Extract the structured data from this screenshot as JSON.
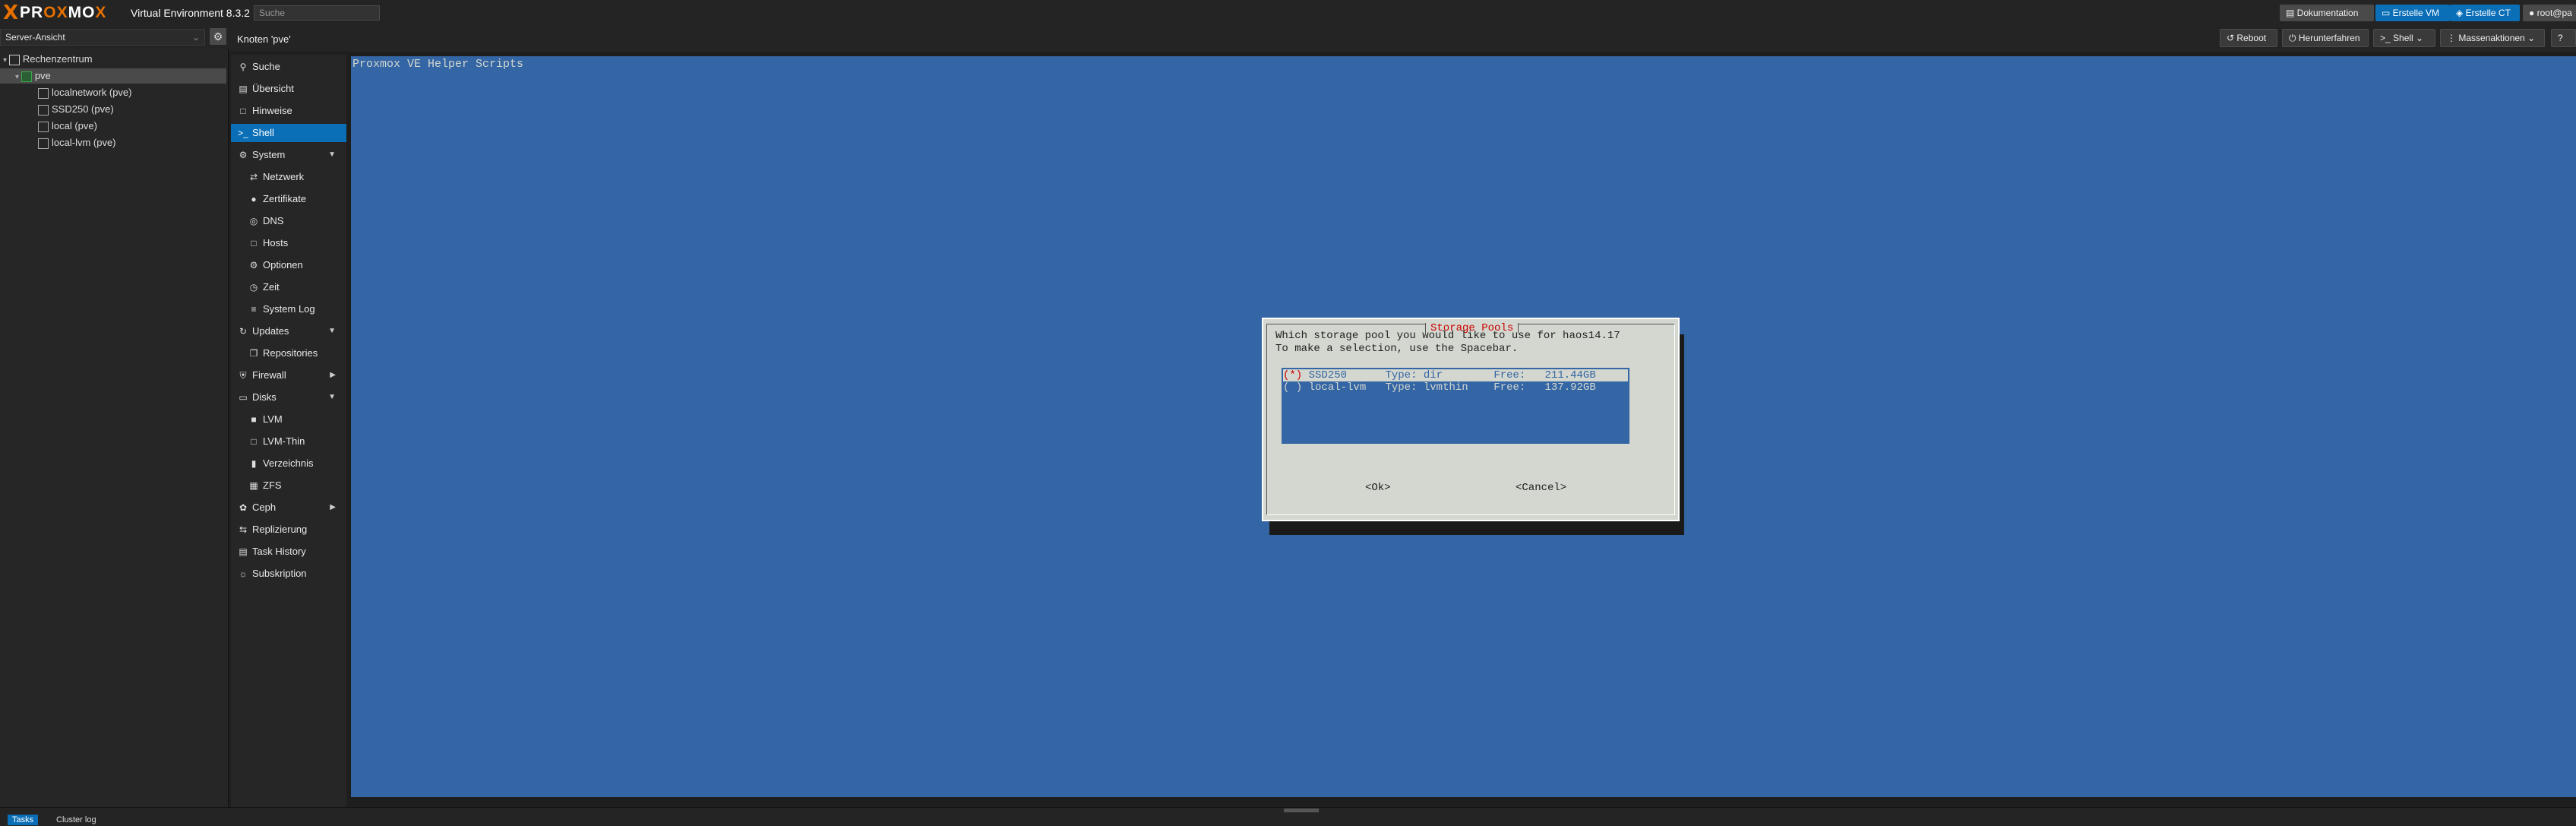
{
  "brand": {
    "logo_x": "X",
    "logo_word_a": "PR",
    "logo_word_b": "OX",
    "logo_word_c": "MO",
    "logo_word_d": "X",
    "version": "Virtual Environment 8.3.2"
  },
  "search": {
    "placeholder": "Suche"
  },
  "top_buttons": {
    "docs": "Dokumentation",
    "create_vm": "Erstelle VM",
    "create_ct": "Erstelle CT",
    "user": "root@pa"
  },
  "view_selector": {
    "value": "Server-Ansicht"
  },
  "node_title": "Knoten 'pve'",
  "node_actions": {
    "reboot": "Reboot",
    "shutdown": "Herunterfahren",
    "shell": "Shell",
    "bulk": "Massenaktionen"
  },
  "tree": {
    "datacenter": "Rechenzentrum",
    "node": "pve",
    "items": [
      "localnetwork (pve)",
      "SSD250 (pve)",
      "local (pve)",
      "local-lvm (pve)"
    ]
  },
  "nav": {
    "items": [
      {
        "label": "Suche",
        "icon": "search-icon"
      },
      {
        "label": "Übersicht",
        "icon": "book-icon"
      },
      {
        "label": "Hinweise",
        "icon": "notes-icon"
      },
      {
        "label": "Shell",
        "icon": "terminal-icon"
      },
      {
        "label": "System",
        "icon": "gears-icon"
      },
      {
        "label": "Netzwerk",
        "icon": "network-icon"
      },
      {
        "label": "Zertifikate",
        "icon": "certificate-icon"
      },
      {
        "label": "DNS",
        "icon": "globe-icon"
      },
      {
        "label": "Hosts",
        "icon": "file-icon"
      },
      {
        "label": "Optionen",
        "icon": "gear-icon"
      },
      {
        "label": "Zeit",
        "icon": "clock-icon"
      },
      {
        "label": "System Log",
        "icon": "list-icon"
      },
      {
        "label": "Updates",
        "icon": "refresh-icon"
      },
      {
        "label": "Repositories",
        "icon": "files-icon"
      },
      {
        "label": "Firewall",
        "icon": "shield-icon"
      },
      {
        "label": "Disks",
        "icon": "hdd-icon"
      },
      {
        "label": "LVM",
        "icon": "square-icon"
      },
      {
        "label": "LVM-Thin",
        "icon": "square-outline-icon"
      },
      {
        "label": "Verzeichnis",
        "icon": "folder-icon"
      },
      {
        "label": "ZFS",
        "icon": "th-large-icon"
      },
      {
        "label": "Ceph",
        "icon": "ceph-icon"
      },
      {
        "label": "Replizierung",
        "icon": "retweet-icon"
      },
      {
        "label": "Task History",
        "icon": "list-alt-icon"
      },
      {
        "label": "Subskription",
        "icon": "support-icon"
      }
    ]
  },
  "terminal": {
    "title": "Proxmox VE Helper Scripts",
    "dialog": {
      "title": "Storage Pools",
      "line1": "Which storage pool you would like to use for haos14.17",
      "line2": "To make a selection, use the Spacebar.",
      "options": [
        {
          "radio": "(*)",
          "name": "SSD250",
          "type": "Type: dir",
          "free": "Free:   211.44GB"
        },
        {
          "radio": "( )",
          "name": "local-lvm",
          "type": "Type: lvmthin",
          "free": "Free:   137.92GB"
        }
      ],
      "ok": "<Ok>",
      "cancel": "<Cancel>"
    }
  },
  "bottom": {
    "tab_tasks": "Tasks",
    "tab_cluster": "Cluster log"
  }
}
